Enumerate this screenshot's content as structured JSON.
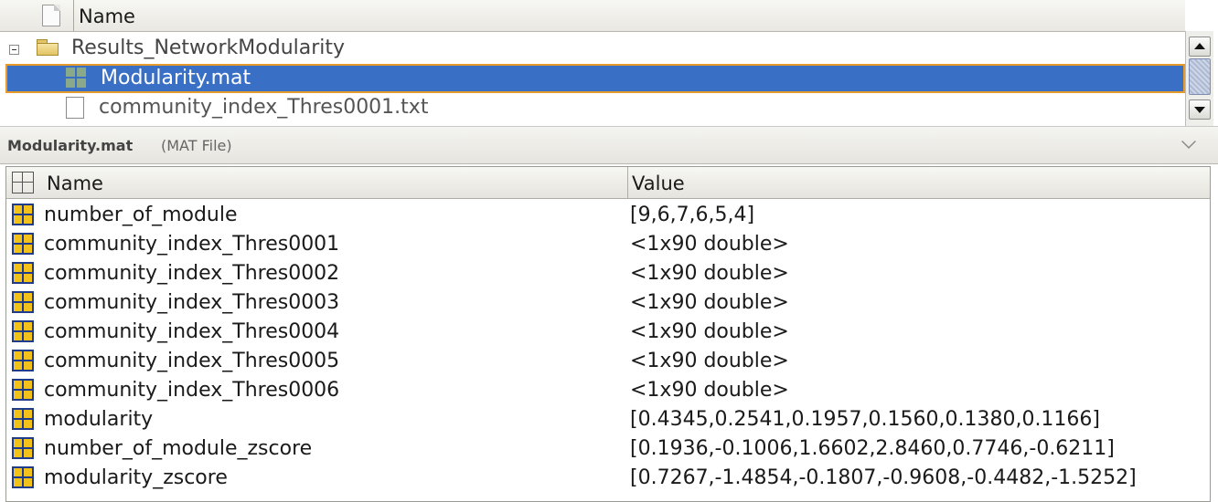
{
  "tree": {
    "header_label": "Name",
    "folder": {
      "label": "Results_NetworkModularity"
    },
    "files": [
      {
        "label": "Modularity.mat",
        "selected": true,
        "icon": "mat-file-icon"
      },
      {
        "label": "community_index_Thres0001.txt",
        "selected": false,
        "icon": "text-file-icon"
      }
    ]
  },
  "details": {
    "title": "Modularity.mat",
    "type": "(MAT File)"
  },
  "variables": {
    "col_name": "Name",
    "col_value": "Value",
    "rows": [
      {
        "name": "number_of_module",
        "value": "[9,6,7,6,5,4]"
      },
      {
        "name": "community_index_Thres0001",
        "value": "<1x90 double>"
      },
      {
        "name": "community_index_Thres0002",
        "value": "<1x90 double>"
      },
      {
        "name": "community_index_Thres0003",
        "value": "<1x90 double>"
      },
      {
        "name": "community_index_Thres0004",
        "value": "<1x90 double>"
      },
      {
        "name": "community_index_Thres0005",
        "value": "<1x90 double>"
      },
      {
        "name": "community_index_Thres0006",
        "value": "<1x90 double>"
      },
      {
        "name": "modularity",
        "value": "[0.4345,0.2541,0.1957,0.1560,0.1380,0.1166]"
      },
      {
        "name": "number_of_module_zscore",
        "value": "[0.1936,-0.1006,1.6602,2.8460,0.7746,-0.6211]"
      },
      {
        "name": "modularity_zscore",
        "value": "[0.7267,-1.4854,-0.1807,-0.9608,-0.4482,-1.5252]"
      }
    ]
  },
  "colors": {
    "selection": "#3a6fc6",
    "selection_border": "#e69b2a",
    "variable_icon": "#f3c21a"
  }
}
